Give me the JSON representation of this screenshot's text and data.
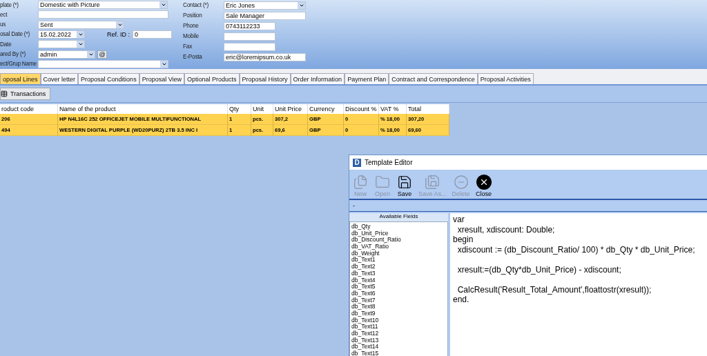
{
  "form": {
    "left_rows": [
      {
        "label": "plate (*)",
        "field": {
          "kind": "combo",
          "value": "Domestic with Picture"
        }
      },
      {
        "label": "ect",
        "field": {
          "kind": "text"
        }
      },
      {
        "label": "us",
        "field": {
          "kind": "combo",
          "value": "Sent"
        }
      },
      {
        "label": "osal Date (*)",
        "field": {
          "kind": "combo",
          "value": "15.02.2022"
        },
        "extra": {
          "kind": "ref",
          "label": "Ref. ID :",
          "value": "0"
        }
      },
      {
        "label": "Date",
        "field": {
          "kind": "combo"
        }
      },
      {
        "label": "ared By (*)",
        "field": {
          "kind": "combo",
          "value": "admin"
        },
        "extra": {
          "kind": "button",
          "label": "@"
        }
      },
      {
        "label": "ect/Grup Name",
        "field": {
          "kind": "combo"
        }
      }
    ],
    "right_rows": [
      {
        "label": "Contact (*)",
        "field": {
          "kind": "combo",
          "value": "Eric Jones"
        }
      },
      {
        "label": "Position",
        "field": {
          "kind": "text",
          "value": "Sale Manager"
        }
      },
      {
        "label": "Phone",
        "field": {
          "kind": "text",
          "value": "0743112233"
        }
      },
      {
        "label": "Mobile",
        "field": {
          "kind": "text"
        }
      },
      {
        "label": "Fax",
        "field": {
          "kind": "text"
        }
      },
      {
        "label": "E-Posta",
        "field": {
          "kind": "text",
          "value": "eric@loremipsum.co.uk"
        }
      }
    ]
  },
  "tabs": [
    {
      "label": "oposal Lines",
      "selected": true
    },
    {
      "label": "Cover letter",
      "selected": false
    },
    {
      "label": "Proposal Conditions",
      "selected": false
    },
    {
      "label": "Proposal View",
      "selected": false
    },
    {
      "label": "Optional Products",
      "selected": false
    },
    {
      "label": "Proposal History",
      "selected": false
    },
    {
      "label": "Order Information",
      "selected": false
    },
    {
      "label": "Payment Plan",
      "selected": false
    },
    {
      "label": "Contract and Correspondence",
      "selected": false
    },
    {
      "label": "Proposal Activities",
      "selected": false
    }
  ],
  "transactions_button": "Transactions",
  "table": {
    "columns": [
      "roduct code",
      "Name of the product",
      "Qty",
      "Unit",
      "Unit Price",
      "Currency",
      "Discount %",
      "VAT %",
      "Total"
    ],
    "rows": [
      {
        "selected": true,
        "cells": [
          "206",
          "HP N4L16C 252 OFFICEJET MOBILE MULTIFUNCTIONAL",
          "1",
          "pcs.",
          "307,2",
          "GBP",
          "0",
          "% 18,00",
          "307,20"
        ]
      },
      {
        "selected": true,
        "cells": [
          "494",
          "WESTERN DIGITAL PURPLE (WD20PURZ) 2TB 3.5 INC I",
          "1",
          "pcs.",
          "69,6",
          "GBP",
          "0",
          "% 18,00",
          "69,60"
        ]
      }
    ]
  },
  "editor": {
    "logo_letter": "D",
    "title": "Template Editor",
    "toolbar": [
      {
        "kind": "new",
        "label": "New",
        "disabled": true
      },
      {
        "kind": "open",
        "label": "Open",
        "disabled": true
      },
      {
        "kind": "save",
        "label": "Save",
        "disabled": false
      },
      {
        "kind": "save-as",
        "label": "Save As...",
        "disabled": true
      },
      {
        "kind": "delete",
        "label": "Delete",
        "disabled": true
      },
      {
        "kind": "close",
        "label": "Close",
        "disabled": false
      }
    ],
    "path": "-",
    "fields_header": "Available Fields",
    "fields": [
      "db_Qty",
      "db_Unit_Price",
      "db_Discount_Ratio",
      "db_VAT_Ratio",
      "db_Weight",
      "db_Text1",
      "db_Text2",
      "db_Text3",
      "db_Text4",
      "db_Text5",
      "db_Text6",
      "db_Text7",
      "db_Text8",
      "db_Text9",
      "db_Text10",
      "db_Text11",
      "db_Text12",
      "db_Text13",
      "db_Text14",
      "db_Text15"
    ],
    "code": "var\n  xresult, xdiscount: Double;\nbegin\n  xdiscount := (db_Discount_Ratio/ 100) * db_Qty * db_Unit_Price;\n\n  xresult:=(db_Qty*db_Unit_Price) - xdiscount;\n\n  CalcResult('Result_Total_Amount',floattostr(xresult));\nend."
  }
}
